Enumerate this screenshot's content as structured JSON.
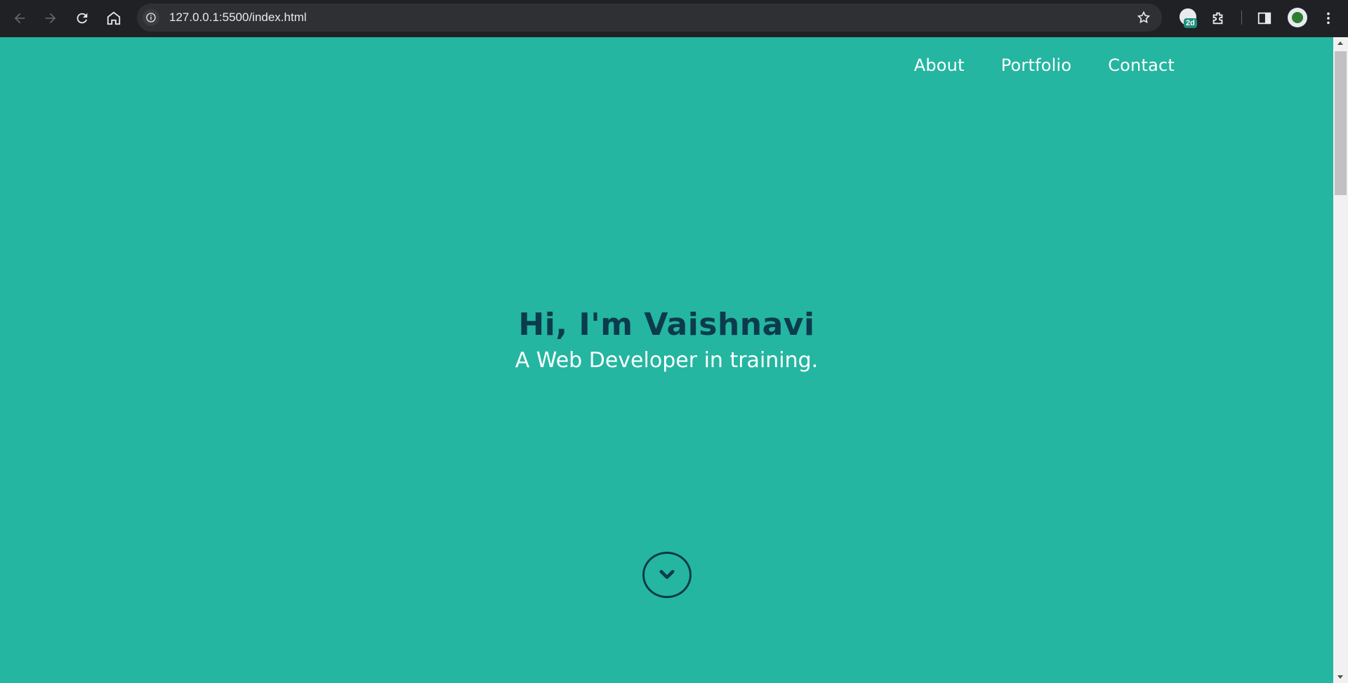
{
  "browser": {
    "url": "127.0.0.1:5500/index.html",
    "extension_badge": "2d",
    "icons": [
      "back-arrow-icon",
      "forward-arrow-icon",
      "reload-icon",
      "home-icon",
      "site-info-icon",
      "star-icon",
      "extension-badge-icon",
      "puzzle-extensions-icon",
      "side-panel-icon",
      "profile-avatar-icon",
      "kebab-menu-icon"
    ]
  },
  "nav": {
    "items": [
      {
        "label": "About"
      },
      {
        "label": "Portfolio"
      },
      {
        "label": "Contact"
      }
    ]
  },
  "hero": {
    "heading": "Hi, I'm Vaishnavi",
    "subheading": "A Web Developer in training."
  },
  "colors": {
    "background": "#24b6a1",
    "heading": "#0c3b4d",
    "text": "#ffffff",
    "chrome": "#202124"
  },
  "scroll_icon": "chevron-down-circle-icon"
}
